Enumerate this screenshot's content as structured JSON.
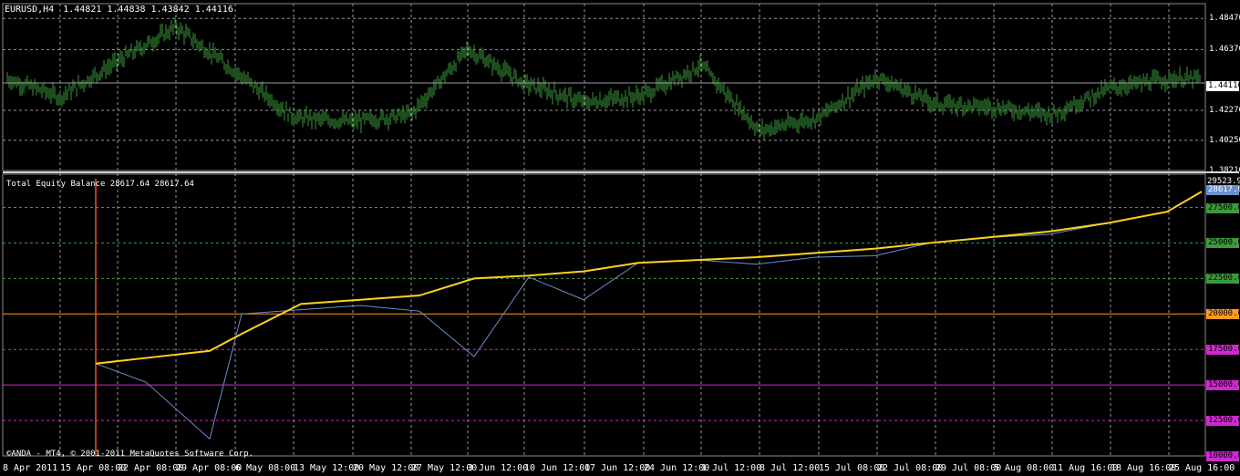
{
  "window": {
    "symbol_label": "EURUSD,H4",
    "ohlc": "1.44821 1.44838 1.43842 1.44116",
    "copyright": "©ANDA - MT4, © 2001-2011 MetaQuotes Software Corp.",
    "current_price": "1.44116"
  },
  "indicator": {
    "label": "Total Equity Balance 28617.64 28617.64",
    "top_value": "29523.9",
    "current_value": "28617.6"
  },
  "colors": {
    "background": "#000000",
    "price_bars": "#3c9a3c",
    "grid": "#c8c8c8",
    "balance": "#ffd21e",
    "equity": "#6a8fd0",
    "level_green": "#3c9a3c",
    "level_orange": "#ff9a1e",
    "level_magenta": "#d028d0",
    "start_marker": "#ff4a1a"
  },
  "chart_data": [
    {
      "type": "line",
      "name": "price",
      "x": [
        "8 Apr 2011",
        "15 Apr 08:00",
        "22 Apr 08:00",
        "29 Apr 08:00",
        "6 May 08:00",
        "13 May 12:00",
        "20 May 12:00",
        "27 May 12:00",
        "3 Jun 12:00",
        "10 Jun 12:00",
        "17 Jun 12:00",
        "24 Jun 12:00",
        "1 Jul 12:00",
        "8 Jul 12:00",
        "15 Jul 08:00",
        "22 Jul 08:00",
        "29 Jul 08:00",
        "5 Aug 08:00",
        "11 Aug 16:00",
        "18 Aug 16:00",
        "25 Aug 16:00"
      ],
      "y": [
        1.4441,
        1.4318,
        1.4557,
        1.479,
        1.449,
        1.418,
        1.415,
        1.42,
        1.464,
        1.441,
        1.428,
        1.433,
        1.453,
        1.409,
        1.418,
        1.445,
        1.427,
        1.425,
        1.42,
        1.438,
        1.444
      ],
      "ylim": [
        1.3821,
        1.4947
      ],
      "yticks": [
        "1.48470",
        "1.46370",
        "1.44116",
        "1.42270",
        "1.40250",
        "1.38210"
      ]
    },
    {
      "type": "line",
      "name": "balance-equity",
      "x": [
        "15 Apr 08:00",
        "22 Apr 08:00",
        "29 Apr 08:00",
        "6 May 08:00",
        "13 May 12:00",
        "20 May 12:00",
        "27 May 12:00",
        "3 Jun 12:00",
        "10 Jun 12:00",
        "17 Jun 12:00",
        "24 Jun 12:00",
        "1 Jul 12:00",
        "8 Jul 12:00",
        "15 Jul 08:00",
        "22 Jul 08:00",
        "29 Jul 08:00",
        "5 Aug 08:00",
        "11 Aug 16:00",
        "18 Aug 16:00",
        "25 Aug 16:00",
        "26 Aug 16:00"
      ],
      "balance": [
        16500,
        16900,
        17400,
        18600,
        20700,
        21000,
        21300,
        22500,
        22700,
        23000,
        23600,
        23800,
        24000,
        24300,
        24600,
        25000,
        25400,
        25800,
        26400,
        27200,
        28617.64
      ],
      "equity": [
        16500,
        15200,
        11200,
        20000,
        20300,
        20600,
        20200,
        17000,
        22600,
        21000,
        23600,
        23800,
        23500,
        24000,
        24100,
        25000,
        25400,
        25600,
        26400,
        27200,
        28617.64
      ],
      "ylim": [
        10000,
        29523.9
      ],
      "yticks": [
        "27500.00",
        "25000.00",
        "22500.00",
        "20000.00",
        "17500.00",
        "15000.00",
        "12500.00",
        "10000.00"
      ]
    }
  ]
}
